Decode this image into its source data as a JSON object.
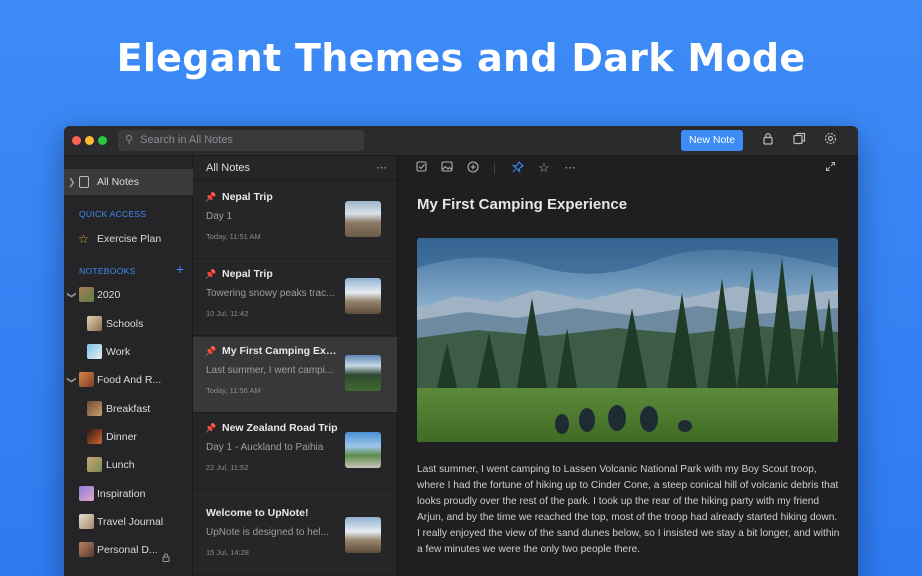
{
  "headline": "Elegant Themes and Dark Mode",
  "toolbar": {
    "search_placeholder": "Search in All Notes",
    "new_note_label": "New Note",
    "icons": [
      "lock-icon",
      "duplicate-window-icon",
      "settings-icon"
    ]
  },
  "sidebar": {
    "all_notes": "All Notes",
    "quick_access_header": "QUICK ACCESS",
    "quick_access_items": [
      {
        "label": "Exercise Plan",
        "icon": "star-icon"
      }
    ],
    "notebooks_header": "NOTEBOOKS",
    "notebooks": [
      {
        "label": "2020",
        "expanded": true
      },
      {
        "label": "Schools"
      },
      {
        "label": "Work"
      },
      {
        "label": "Food And R...",
        "expanded": true
      },
      {
        "label": "Breakfast"
      },
      {
        "label": "Dinner"
      },
      {
        "label": "Lunch"
      },
      {
        "label": "Inspiration"
      },
      {
        "label": "Travel Journal"
      },
      {
        "label": "Personal D...",
        "locked": true
      }
    ]
  },
  "notelist": {
    "header": "All Notes",
    "notes": [
      {
        "title": "Nepal Trip",
        "preview": "Day 1",
        "date": "Today, 11:51 AM",
        "pinned": true
      },
      {
        "title": "Nepal Trip",
        "preview": "Towering snowy peaks trac...",
        "date": "10 Jul, 11:42",
        "pinned": true
      },
      {
        "title": "My First Camping Expe...",
        "preview": "Last summer, I went campi...",
        "date": "Today, 11:56 AM",
        "pinned": true,
        "selected": true
      },
      {
        "title": "New Zealand Road Trip",
        "preview": "Day 1 - Auckland to Paihia",
        "date": "22 Jul, 11:52",
        "pinned": true
      },
      {
        "title": "Welcome to UpNote!",
        "preview": "UpNote is designed to hel...",
        "date": "15 Jul, 14:28",
        "pinned": false
      }
    ]
  },
  "editor": {
    "toolbar_icons": [
      "checkbox-icon",
      "image-icon",
      "add-icon",
      "pin-icon",
      "star-icon",
      "more-icon",
      "expand-icon"
    ],
    "title": "My First Camping Experience",
    "body": "Last summer, I went camping to Lassen Volcanic National Park with my Boy Scout troop, where I had the fortune of hiking up to Cinder Cone, a steep conical hill of volcanic debris that looks proudly over the rest of the park. I took up the rear of the hiking party with my friend Arjun, and by the time we reached the top, most of the troop had already started hiking down. I really enjoyed the view of the sand dunes below, so I insisted we stay a bit longer, and within a few minutes we were the only two people there."
  },
  "colors": {
    "accent": "#3d8bf7",
    "background_gradient": "#3d8bf7",
    "window_bg": "#232325"
  }
}
